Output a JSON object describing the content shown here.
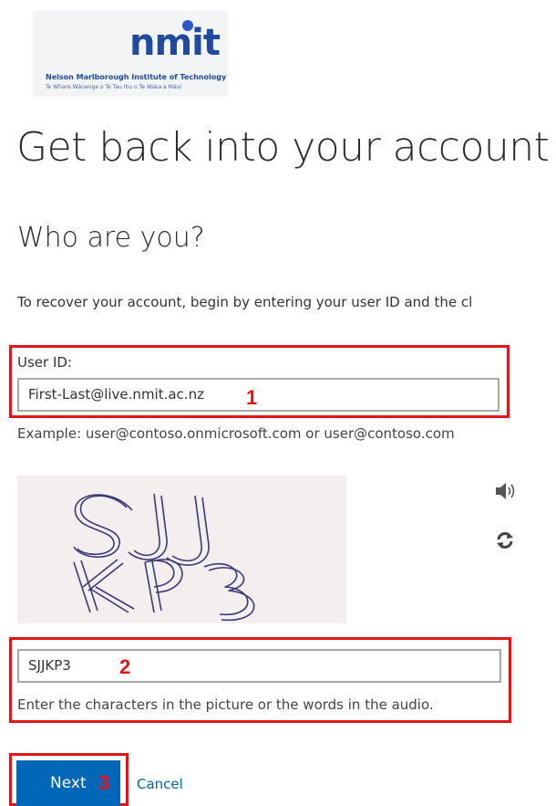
{
  "logo": {
    "word": "nmit",
    "tagline_1": "Nelson Marlborough Institute of Technology",
    "tagline_2": "Te Whare Wānanga o Te Tau Ihu o Te Waka a Māui"
  },
  "page": {
    "title": "Get back into your account",
    "subtitle": "Who are you?",
    "intro": "To recover your account, begin by entering your user ID and the cl"
  },
  "userid": {
    "label": "User ID:",
    "value": "First-Last@live.nmit.ac.nz",
    "example": "Example: user@contoso.onmicrosoft.com or user@contoso.com"
  },
  "captcha": {
    "image_text": "SJJKP3",
    "audio_icon": "speaker-icon",
    "refresh_icon": "refresh-icon",
    "input_value": "SJJKP3",
    "hint": "Enter the characters in the picture or the words in the audio."
  },
  "annotations": {
    "step1": "1",
    "step2": "2",
    "step3": "3",
    "color": "#e0161b"
  },
  "actions": {
    "next_label": "Next",
    "cancel_label": "Cancel"
  },
  "colors": {
    "primary": "#0067b8",
    "logo_blue": "#1f4aa0"
  }
}
